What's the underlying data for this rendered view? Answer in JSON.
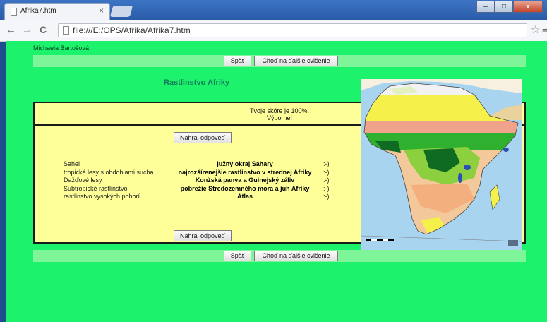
{
  "browser": {
    "tab_title": "Afrika7.htm",
    "tab_close": "×",
    "url": "file:///E:/OPS/Afrika/Afrika7.htm",
    "back_icon": "←",
    "forward_icon": "→",
    "reload_icon": "C",
    "star_icon": "☆",
    "menu_icon": "≡",
    "minimize": "–",
    "maximize": "□",
    "close": "x"
  },
  "page": {
    "author": "Michaela Bartošová",
    "nav": {
      "back_label": "Späť",
      "next_label": "Choď na ďalšie cvičenie"
    },
    "heading": "Rastlinstvo Afriky",
    "score_line": "Tvoje skóre je 100%.",
    "praise_line": "Výborne!",
    "submit_label": "Nahraj odpoveď",
    "rows": [
      {
        "label": "Sahel",
        "answer": "južný okraj Sahary",
        "mark": ":-)"
      },
      {
        "label": "tropické lesy s obdobiami sucha",
        "answer": "najrozšírenejšie rastlinstvo v strednej Afriky",
        "mark": ":-)"
      },
      {
        "label": "Dažďové lesy",
        "answer": "Konžská panva a Guinejský záliv",
        "mark": ":-)"
      },
      {
        "label": "Subtropické rastlinstvo",
        "answer": "pobrežie Stredozemného mora a juh Afriky",
        "mark": ":-)"
      },
      {
        "label": "rastlinstvo vysokých pohorí",
        "answer": "Atlas",
        "mark": ":-)"
      }
    ]
  },
  "colors": {
    "page_bg": "#1cf26c",
    "nav_bar": "#7ff59a",
    "quiz_bg": "#ffff99",
    "heading": "#117a5a"
  }
}
